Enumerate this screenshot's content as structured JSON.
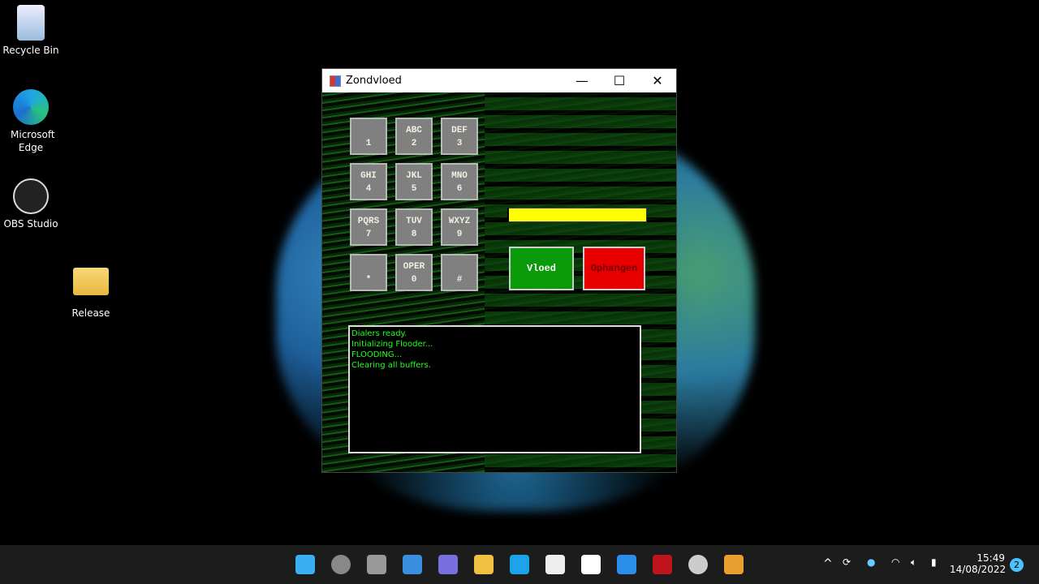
{
  "desktop": {
    "icons": [
      {
        "label": "Recycle Bin",
        "icon": "recycle-bin-icon"
      },
      {
        "label": "Microsoft Edge",
        "icon": "edge-icon"
      },
      {
        "label": "OBS Studio",
        "icon": "obs-icon"
      },
      {
        "label": "Release",
        "icon": "folder-icon"
      }
    ]
  },
  "window": {
    "title": "Zondvloed",
    "minimize": "—",
    "maximize": "☐",
    "close": "✕"
  },
  "keypad": [
    {
      "l": "",
      "d": "1"
    },
    {
      "l": "ABC",
      "d": "2"
    },
    {
      "l": "DEF",
      "d": "3"
    },
    {
      "l": "GHI",
      "d": "4"
    },
    {
      "l": "JKL",
      "d": "5"
    },
    {
      "l": "MNO",
      "d": "6"
    },
    {
      "l": "PQRS",
      "d": "7"
    },
    {
      "l": "TUV",
      "d": "8"
    },
    {
      "l": "WXYZ",
      "d": "9"
    },
    {
      "l": "",
      "d": "*"
    },
    {
      "l": "OPER",
      "d": "0"
    },
    {
      "l": "",
      "d": "#"
    }
  ],
  "number_input": {
    "value": ""
  },
  "buttons": {
    "flood": "Vloed",
    "hangup": "Ophangen"
  },
  "colors": {
    "flood": "#0a9a0a",
    "hangup": "#e80000",
    "input": "#ffff00",
    "log_text": "#22ff22"
  },
  "log": [
    "Dialers ready.",
    "Initializing Flooder...",
    "FLOODING...",
    "Clearing all buffers."
  ],
  "taskbar": {
    "apps": [
      "start",
      "search",
      "task-view",
      "widgets",
      "chat",
      "file-explorer",
      "edge",
      "store",
      "app",
      "help",
      "mcafee",
      "obs",
      "zondvloed"
    ],
    "time": "15:49",
    "date": "14/08/2022",
    "notifications": "2"
  }
}
